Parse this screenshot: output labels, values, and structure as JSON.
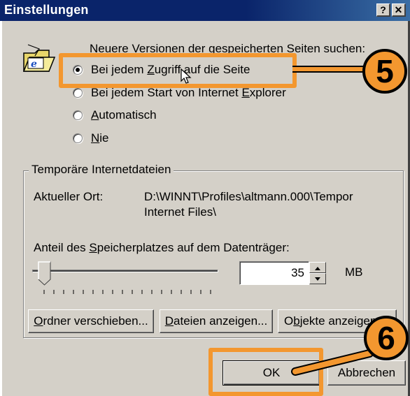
{
  "window": {
    "title": "Einstellungen",
    "help_label": "?",
    "close_label": "✕"
  },
  "check_section": {
    "heading": "Neuere Versionen der gespeicherten Seiten suchen:",
    "options": [
      {
        "pre": "Bei jedem ",
        "hot": "Z",
        "post": "ugriff auf die Seite",
        "selected": true
      },
      {
        "pre": "Bei jedem Start von Internet ",
        "hot": "E",
        "post": "xplorer",
        "selected": false
      },
      {
        "pre": "",
        "hot": "A",
        "post": "utomatisch",
        "selected": false
      },
      {
        "pre": "",
        "hot": "N",
        "post": "ie",
        "selected": false
      }
    ]
  },
  "temp_files": {
    "group_title": "Temporäre Internetdateien",
    "location_label": "Aktueller Ort:",
    "location_line1": "D:\\WINNT\\Profiles\\altmann.000\\Tempor",
    "location_line2": "Internet Files\\",
    "space_label_pre": "Anteil des ",
    "space_label_hot": "S",
    "space_label_post": "peicherplatzes auf dem Datenträger:",
    "slider_percent": 3,
    "size_value": "35",
    "size_unit": "MB"
  },
  "buttons": {
    "move_hot": "O",
    "move_rest": "rdner verschieben...",
    "files_hot": "D",
    "files_rest": "ateien anzeigen...",
    "objects_pre": "O",
    "objects_hot": "b",
    "objects_rest": "jekte anzeigen...",
    "ok": "OK",
    "cancel": "Abbrechen"
  },
  "annotations": {
    "step_a": "5",
    "step_b": "6",
    "accent_color": "#f3972f"
  },
  "icons": {
    "folder_ie": "folder-ie-icon",
    "cursor": "cursor-icon"
  }
}
